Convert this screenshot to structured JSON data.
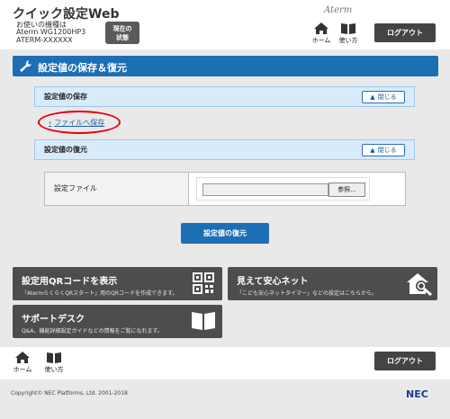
{
  "header": {
    "app_title": "クイック設定Web",
    "device_label": "お使いの機種は",
    "device_model": "Aterm WG1200HP3",
    "device_id": "ATERM-XXXXXX",
    "status_button": [
      "現在の",
      "状態"
    ],
    "brand_logo": "Aterm",
    "home_label": "ホーム",
    "howto_label": "使い方",
    "logout_label": "ログアウト"
  },
  "page": {
    "title": "設定値の保存＆復元"
  },
  "save_section": {
    "heading": "設定値の保存",
    "close_label": "閉じる",
    "link_label": "ファイルへ保存"
  },
  "restore_section": {
    "heading": "設定値の復元",
    "close_label": "閉じる",
    "file_label": "設定ファイル",
    "file_value": "",
    "browse_label": "参照...",
    "restore_button": "設定値の復元"
  },
  "tiles": [
    {
      "title": "設定用QRコードを表示",
      "desc": "「AtermらくらくQRスタート」用のQRコードを作成できます。",
      "icon": "qr-code-icon"
    },
    {
      "title": "見えて安心ネット",
      "desc": "「こども安心ネットタイマー」などの設定はこちらから。",
      "icon": "house-search-icon"
    },
    {
      "title": "サポートデスク",
      "desc": "Q&A、機能詳細設定ガイドなどの情報をご覧になれます。",
      "icon": "book-icon"
    }
  ],
  "footer": {
    "home_label": "ホーム",
    "howto_label": "使い方",
    "logout_label": "ログアウト",
    "copyright": "Copyright© NEC Platforms, Ltd. 2001-2018",
    "nec_logo": "NEC"
  },
  "colors": {
    "accent_blue": "#1c6eb5",
    "section_bg": "#d8ebfb",
    "tile_bg": "#4d4d4d",
    "highlight_red": "#e40014"
  }
}
